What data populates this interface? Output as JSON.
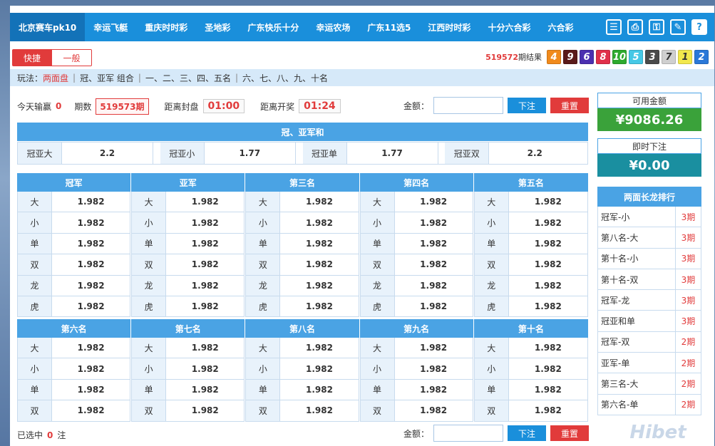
{
  "nav": {
    "items": [
      "北京赛车pk10",
      "幸运飞艇",
      "重庆时时彩",
      "圣地彩",
      "广东快乐十分",
      "幸运农场",
      "广东11选5",
      "江西时时彩",
      "十分六合彩",
      "六合彩"
    ],
    "icons": [
      "list-icon",
      "print-icon",
      "key-icon",
      "edit-icon",
      "help-icon"
    ],
    "icon_glyphs": [
      "☰",
      "⎙",
      "⚿",
      "✎",
      "?"
    ]
  },
  "mode": {
    "tab1": "快捷",
    "tab2": "一般"
  },
  "results": {
    "period": "519572",
    "suffix": "期结果",
    "balls": [
      {
        "n": "4",
        "color": "#f08a1c"
      },
      {
        "n": "9",
        "color": "#5a1a1a"
      },
      {
        "n": "6",
        "color": "#4b2fb0"
      },
      {
        "n": "8",
        "color": "#e0304a"
      },
      {
        "n": "10",
        "color": "#2eaa2e"
      },
      {
        "n": "5",
        "color": "#45c8e6"
      },
      {
        "n": "3",
        "color": "#4a4a4a"
      },
      {
        "n": "7",
        "color": "#cfcfcf"
      },
      {
        "n": "1",
        "color": "#f2e84c"
      },
      {
        "n": "2",
        "color": "#2a78d8"
      }
    ]
  },
  "play": {
    "label": "玩法：",
    "items": [
      "两面盘",
      "冠、亚军 组合",
      "一、二、三、四、五名",
      "六、七、八、九、十名"
    ]
  },
  "info": {
    "today_label": "今天输赢",
    "today_value": "0",
    "period_label": "期数",
    "period_value": "519573期",
    "close_label": "距离封盘",
    "close_value": "01:00",
    "draw_label": "距离开奖",
    "draw_value": "01:24"
  },
  "bet": {
    "amount_label": "金额：",
    "submit": "下注",
    "reset": "重置"
  },
  "sum": {
    "title": "冠、亚军和",
    "items": [
      {
        "k": "冠亚大",
        "v": "2.2"
      },
      {
        "k": "冠亚小",
        "v": "1.77"
      },
      {
        "k": "冠亚单",
        "v": "1.77"
      },
      {
        "k": "冠亚双",
        "v": "2.2"
      }
    ]
  },
  "grid1": {
    "heads": [
      "冠军",
      "亚军",
      "第三名",
      "第四名",
      "第五名"
    ],
    "keys": [
      "大",
      "小",
      "单",
      "双",
      "龙",
      "虎"
    ],
    "odds": "1.982"
  },
  "grid2": {
    "heads": [
      "第六名",
      "第七名",
      "第八名",
      "第九名",
      "第十名"
    ],
    "keys": [
      "大",
      "小",
      "单",
      "双"
    ],
    "odds": "1.982"
  },
  "side": {
    "balance_label": "可用金额",
    "balance_value": "¥9086.26",
    "instant_label": "即时下注",
    "instant_value": "¥0.00",
    "long_title": "两面长龙排行",
    "long": [
      {
        "n": "冠军-小",
        "c": "3期"
      },
      {
        "n": "第八名-大",
        "c": "3期"
      },
      {
        "n": "第十名-小",
        "c": "3期"
      },
      {
        "n": "第十名-双",
        "c": "3期"
      },
      {
        "n": "冠军-龙",
        "c": "3期"
      },
      {
        "n": "冠亚和单",
        "c": "3期"
      },
      {
        "n": "冠军-双",
        "c": "2期"
      },
      {
        "n": "亚军-单",
        "c": "2期"
      },
      {
        "n": "第三名-大",
        "c": "2期"
      },
      {
        "n": "第六名-单",
        "c": "2期"
      }
    ]
  },
  "bottom": {
    "selected_label": "已选中",
    "selected_count": "0",
    "selected_unit": "注"
  },
  "watermark": "Hibet"
}
